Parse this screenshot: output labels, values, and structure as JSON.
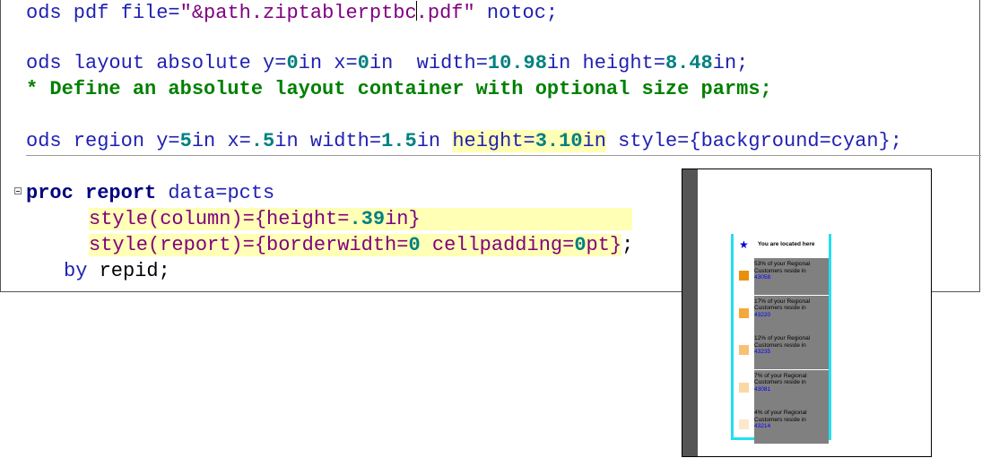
{
  "code": {
    "l1": {
      "a": "ods pdf file=",
      "b": "\"&path.ziptablerptbc",
      "c": ".pdf\"",
      "d": " notoc;"
    },
    "l2": {
      "a": "ods layout absolute y=",
      "b": "0",
      "c": "in x=",
      "d": "0",
      "e": "in  width=",
      "f": "10.98",
      "g": "in height=",
      "h": "8.48",
      "i": "in;"
    },
    "l3": {
      "a": "* Define an absolute layout container with optional size parms;"
    },
    "l4": {
      "a": "ods region y=",
      "b": "5",
      "c": "in x=",
      "d": ".5",
      "e": "in width=",
      "f": "1.5",
      "g": "in ",
      "h": "height=",
      "i": "3.10",
      "j": "in",
      "k": " style={background=cyan};"
    },
    "l5": {
      "a": "proc report",
      "b": " data=pcts"
    },
    "l6": {
      "a": "style(column)={height=",
      "b": ".39",
      "c": "in}"
    },
    "l7": {
      "a": "style(report)={borderwidth=",
      "b": "0",
      "c": " cellpadding=",
      "d": "0",
      "e": "pt}",
      "f": ";"
    },
    "l8": {
      "a": "by",
      "b": " repid;"
    }
  },
  "preview": {
    "header": "You are located here",
    "star_icon": "star-icon",
    "rows": [
      {
        "line1": "53% of your Regional",
        "line2": "Customers reside in",
        "zip": "43058",
        "color": "#e8900c"
      },
      {
        "line1": "17% of your Regional",
        "line2": "Customers reside in",
        "zip": "43220",
        "color": "#f5a83a"
      },
      {
        "line1": "12% of your Regional",
        "line2": "Customers reside in",
        "zip": "43235",
        "color": "#f9c070"
      },
      {
        "line1": "7% of your Regional",
        "line2": "Customers reside in",
        "zip": "43081",
        "color": "#fbd7a4"
      },
      {
        "line1": "4% of your Regional",
        "line2": "Customers reside in",
        "zip": "43214",
        "color": "#fde8cc"
      }
    ]
  },
  "colors": {
    "region_border": "#22e0f0",
    "cell_bg": "#808080",
    "highlight": "#ffffb5"
  }
}
